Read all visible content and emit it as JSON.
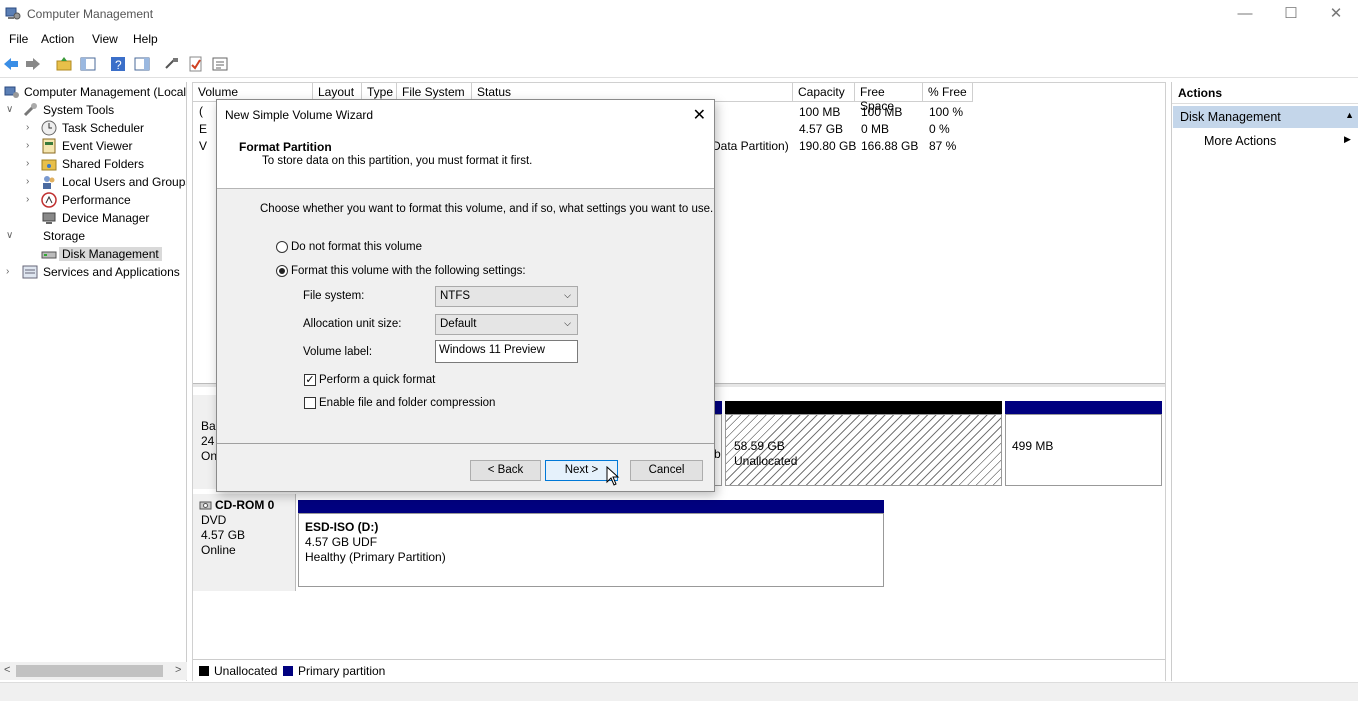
{
  "window": {
    "title": "Computer Management",
    "minimize": "—",
    "maximize": "☐",
    "close": "✕"
  },
  "menu": [
    "File",
    "Action",
    "View",
    "Help"
  ],
  "tree": {
    "root": "Computer Management (Local",
    "system_tools": "System Tools",
    "task_scheduler": "Task Scheduler",
    "event_viewer": "Event Viewer",
    "shared_folders": "Shared Folders",
    "local_users": "Local Users and Groups",
    "performance": "Performance",
    "device_manager": "Device Manager",
    "storage": "Storage",
    "disk_management": "Disk Management",
    "services": "Services and Applications"
  },
  "volumes": {
    "headers": [
      "Volume",
      "Layout",
      "Type",
      "File System",
      "Status",
      "Capacity",
      "Free Space",
      "% Free"
    ],
    "rows": [
      {
        "volume": "(",
        "status": "",
        "capacity": "100 MB",
        "free": "100 MB",
        "pct": "100 %"
      },
      {
        "volume": "E",
        "status": "",
        "capacity": "4.57 GB",
        "free": "0 MB",
        "pct": "0 %"
      },
      {
        "volume": "V",
        "status": "Data Partition)",
        "capacity": "190.80 GB",
        "free": "166.88 GB",
        "pct": "87 %"
      }
    ]
  },
  "disk0": {
    "label1": "Ba",
    "label2": "24",
    "label3": "On",
    "unalloc_size": "58.59 GB",
    "unalloc_label": "Unallocated",
    "recovery_size": "499 MB",
    "partial": "b"
  },
  "cdrom": {
    "name": "CD-ROM 0",
    "type": "DVD",
    "size": "4.57 GB",
    "state": "Online",
    "vol_name": "ESD-ISO  (D:)",
    "vol_fs": "4.57 GB UDF",
    "vol_status": "Healthy (Primary Partition)"
  },
  "legend": {
    "unallocated": "Unallocated",
    "primary": "Primary partition"
  },
  "actions": {
    "header": "Actions",
    "section": "Disk Management",
    "more": "More Actions"
  },
  "dialog": {
    "title": "New Simple Volume Wizard",
    "heading": "Format Partition",
    "subheading": "To store data on this partition, you must format it first.",
    "prompt": "Choose whether you want to format this volume, and if so, what settings you want to use.",
    "opt_no_format": "Do not format this volume",
    "opt_format": "Format this volume with the following settings:",
    "fs_label": "File system:",
    "fs_value": "NTFS",
    "alloc_label": "Allocation unit size:",
    "alloc_value": "Default",
    "vol_label": "Volume label:",
    "vol_value": "Windows 11 Preview",
    "quick_format": "Perform a quick format",
    "compression": "Enable file and folder compression",
    "back": "< Back",
    "next": "Next >",
    "cancel": "Cancel"
  },
  "colors": {
    "primary_partition": "#00007f",
    "unallocated": "#000000",
    "selection": "#c4d6ea"
  }
}
